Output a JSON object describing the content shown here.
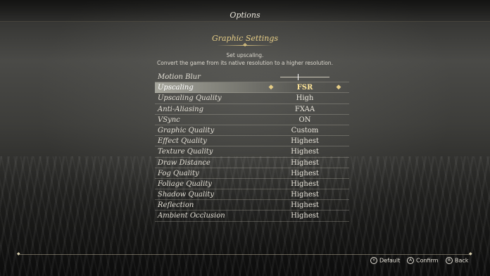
{
  "header": {
    "title": "Options"
  },
  "section": {
    "title": "Graphic Settings",
    "description_line1": "Set upscaling.",
    "description_line2": "Convert the game from its native resolution to a higher resolution."
  },
  "settings": [
    {
      "label": "Motion Blur",
      "type": "slider",
      "level_fraction": 0.36
    },
    {
      "label": "Upscaling",
      "value": "FSR",
      "selected": true
    },
    {
      "label": "Upscaling Quality",
      "value": "High"
    },
    {
      "label": "Anti-Aliasing",
      "value": "FXAA"
    },
    {
      "label": "VSync",
      "value": "ON"
    },
    {
      "label": "Graphic Quality",
      "value": "Custom"
    },
    {
      "label": "Effect Quality",
      "value": "Highest"
    },
    {
      "label": "Texture Quality",
      "value": "Highest"
    },
    {
      "label": "Draw Distance",
      "value": "Highest"
    },
    {
      "label": "Fog Quality",
      "value": "Highest"
    },
    {
      "label": "Foliage Quality",
      "value": "Highest"
    },
    {
      "label": "Shadow Quality",
      "value": "Highest"
    },
    {
      "label": "Reflection",
      "value": "Highest"
    },
    {
      "label": "Ambient Occlusion",
      "value": "Highest"
    }
  ],
  "footer": {
    "default": {
      "button": "Y",
      "label": "Default"
    },
    "confirm": {
      "button": "A",
      "label": "Confirm"
    },
    "back": {
      "button": "B",
      "label": "Back"
    }
  },
  "colors": {
    "accent_gold": "#e6cd86",
    "selected_value": "#ffe69a"
  },
  "icons": {
    "arrow_left": "ornate-left-arrow-icon",
    "arrow_right": "ornate-right-arrow-icon"
  }
}
